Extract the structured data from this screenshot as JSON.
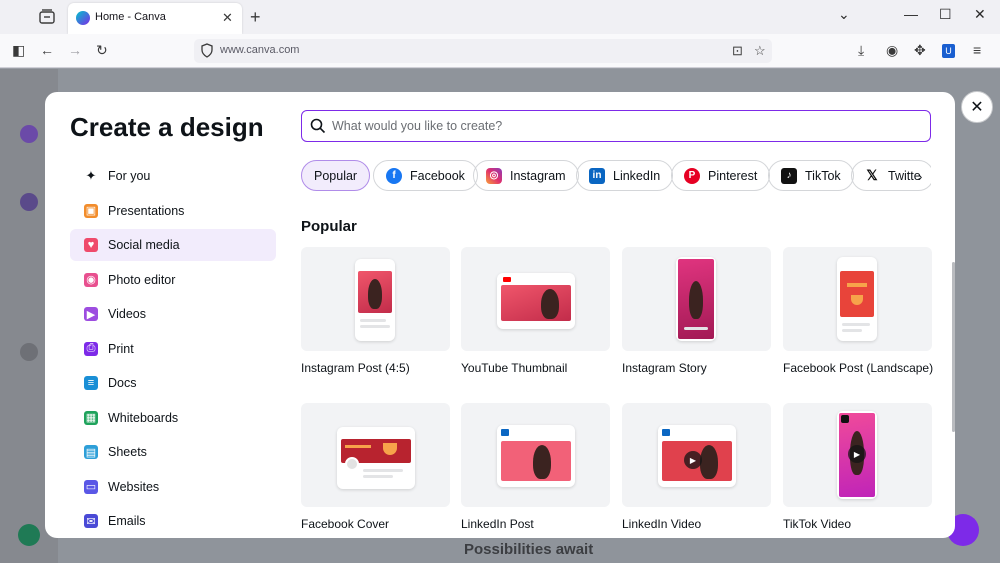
{
  "browser": {
    "tab_title": "Home - Canva",
    "url": "www.canva.com"
  },
  "background": {
    "footer_text": "Possibilities await"
  },
  "modal": {
    "title": "Create a design",
    "search_placeholder": "What would you like to create?",
    "close_label": "✕",
    "section_title": "Popular",
    "sidebar": [
      {
        "label": "For you",
        "icon": "sparkle-icon",
        "color": "#0e1318",
        "active": false
      },
      {
        "label": "Presentations",
        "icon": "presentation-icon",
        "color": "#f28d2c",
        "active": false
      },
      {
        "label": "Social media",
        "icon": "heart-icon",
        "color": "#ef4b6b",
        "active": true
      },
      {
        "label": "Photo editor",
        "icon": "camera-icon",
        "color": "#e8508f",
        "active": false
      },
      {
        "label": "Videos",
        "icon": "video-icon",
        "color": "#9d4de0",
        "active": false
      },
      {
        "label": "Print",
        "icon": "printer-icon",
        "color": "#7d2ae8",
        "active": false
      },
      {
        "label": "Docs",
        "icon": "docs-icon",
        "color": "#1a8fd6",
        "active": false
      },
      {
        "label": "Whiteboards",
        "icon": "whiteboard-icon",
        "color": "#1fa35c",
        "active": false
      },
      {
        "label": "Sheets",
        "icon": "sheets-icon",
        "color": "#2e9fd8",
        "active": false
      },
      {
        "label": "Websites",
        "icon": "website-icon",
        "color": "#5a57e6",
        "active": false
      },
      {
        "label": "Emails",
        "icon": "email-icon",
        "color": "#4a4ad6",
        "active": false
      }
    ],
    "chips": [
      {
        "label": "Popular",
        "icon": "",
        "active": true
      },
      {
        "label": "Facebook",
        "icon": "facebook-icon",
        "active": false
      },
      {
        "label": "Instagram",
        "icon": "instagram-icon",
        "active": false
      },
      {
        "label": "LinkedIn",
        "icon": "linkedin-icon",
        "active": false
      },
      {
        "label": "Pinterest",
        "icon": "pinterest-icon",
        "active": false
      },
      {
        "label": "TikTok",
        "icon": "tiktok-icon",
        "active": false
      },
      {
        "label": "Twitte",
        "icon": "x-icon",
        "active": false
      }
    ],
    "cards": [
      {
        "label": "Instagram Post (4:5)",
        "kind": "instagram-post"
      },
      {
        "label": "YouTube Thumbnail",
        "kind": "youtube-thumbnail"
      },
      {
        "label": "Instagram Story",
        "kind": "instagram-story"
      },
      {
        "label": "Facebook Post (Landscape)",
        "kind": "facebook-post"
      },
      {
        "label": "Facebook Cover",
        "kind": "facebook-cover"
      },
      {
        "label": "LinkedIn Post",
        "kind": "linkedin-post"
      },
      {
        "label": "LinkedIn Video",
        "kind": "linkedin-video"
      },
      {
        "label": "TikTok Video",
        "kind": "tiktok-video"
      }
    ]
  }
}
